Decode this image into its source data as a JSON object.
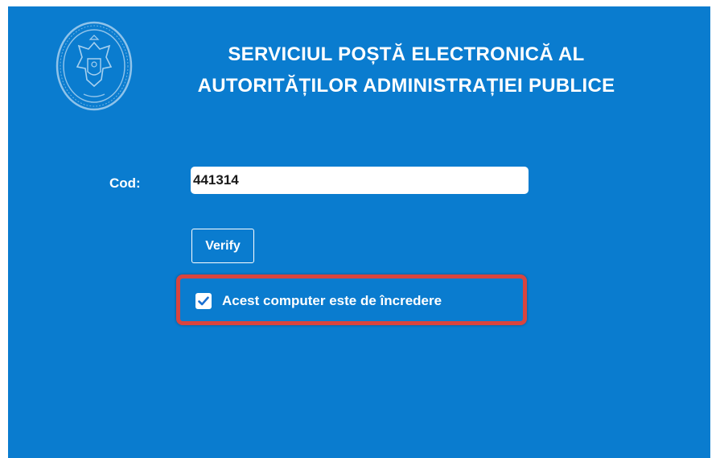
{
  "header": {
    "title_line1": "SERVICIUL POȘTĂ ELECTRONICĂ AL",
    "title_line2": "AUTORITĂȚILOR ADMINISTRAȚIEI PUBLICE",
    "logo_icon": "state-seal-icon"
  },
  "form": {
    "cod_label": "Cod:",
    "cod_value": "441314",
    "verify_label": "Verify",
    "trust_label": "Acest computer este de încredere",
    "trust_checked": true
  },
  "colors": {
    "background": "#0a7ccf",
    "highlight": "#d9443f",
    "text": "#ffffff"
  }
}
